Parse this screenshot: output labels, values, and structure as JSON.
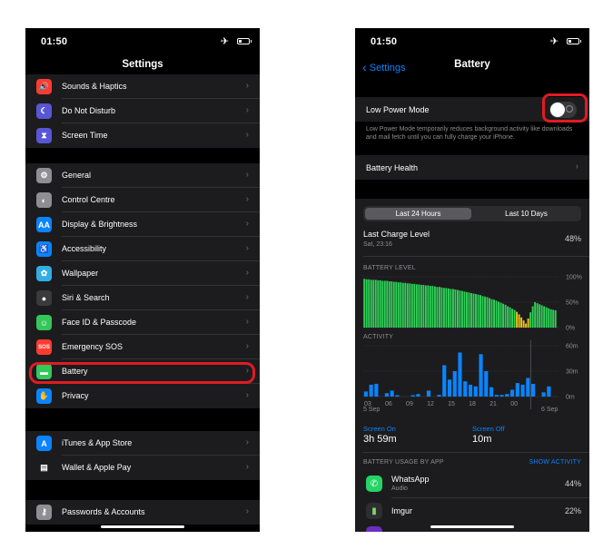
{
  "left": {
    "time": "01:50",
    "title": "Settings",
    "group1": [
      {
        "label": "Sounds & Haptics",
        "icon": "speaker-icon",
        "color": "#ff3b30",
        "glyph": "🔊"
      },
      {
        "label": "Do Not Disturb",
        "icon": "moon-icon",
        "color": "#5856d6",
        "glyph": "☾"
      },
      {
        "label": "Screen Time",
        "icon": "hourglass-icon",
        "color": "#5856d6",
        "glyph": "⧗"
      }
    ],
    "group2": [
      {
        "label": "General",
        "icon": "gear-icon",
        "color": "#8e8e93",
        "glyph": "⚙"
      },
      {
        "label": "Control Centre",
        "icon": "toggles-icon",
        "color": "#8e8e93",
        "glyph": "◐"
      },
      {
        "label": "Display & Brightness",
        "icon": "text-size-icon",
        "color": "#0a84ff",
        "glyph": "AA"
      },
      {
        "label": "Accessibility",
        "icon": "accessibility-icon",
        "color": "#0a84ff",
        "glyph": "♿"
      },
      {
        "label": "Wallpaper",
        "icon": "flower-icon",
        "color": "#32ade6",
        "glyph": "✿"
      },
      {
        "label": "Siri & Search",
        "icon": "siri-icon",
        "color": "#3a3a3c",
        "glyph": "●"
      },
      {
        "label": "Face ID & Passcode",
        "icon": "face-id-icon",
        "color": "#34c759",
        "glyph": "☺"
      },
      {
        "label": "Emergency SOS",
        "icon": "sos-icon",
        "color": "#ff3b30",
        "glyph": "SOS"
      },
      {
        "label": "Battery",
        "icon": "battery-icon",
        "color": "#34c759",
        "glyph": "▬"
      },
      {
        "label": "Privacy",
        "icon": "hand-icon",
        "color": "#0a84ff",
        "glyph": "✋"
      }
    ],
    "group3": [
      {
        "label": "iTunes & App Store",
        "icon": "app-store-icon",
        "color": "#0a84ff",
        "glyph": "A"
      },
      {
        "label": "Wallet & Apple Pay",
        "icon": "wallet-icon",
        "color": "#1c1c1e",
        "glyph": "▤"
      }
    ],
    "group4": [
      {
        "label": "Passwords & Accounts",
        "icon": "key-icon",
        "color": "#8e8e93",
        "glyph": "⚷"
      }
    ]
  },
  "right": {
    "time": "01:50",
    "back_label": "Settings",
    "title": "Battery",
    "low_power_label": "Low Power Mode",
    "low_power_on": false,
    "low_power_note": "Low Power Mode temporarily reduces background activity like downloads and mail fetch until you can fully charge your iPhone.",
    "battery_health_label": "Battery Health",
    "tabs": [
      "Last 24 Hours",
      "Last 10 Days"
    ],
    "last_charge_label": "Last Charge Level",
    "last_charge_time": "Sat, 23:16",
    "last_charge_value": "48%",
    "battery_level_label": "BATTERY LEVEL",
    "battery_level_ticks": [
      "100%",
      "50%",
      "0%"
    ],
    "activity_label": "ACTIVITY",
    "activity_ticks": [
      "60m",
      "30m",
      "0m"
    ],
    "activity_x_labels": [
      "03",
      "06",
      "09",
      "12",
      "15",
      "18",
      "21",
      "00"
    ],
    "date_left": "5 Sep",
    "date_right": "6 Sep",
    "screen_on_label": "Screen On",
    "screen_on_value": "3h 59m",
    "screen_off_label": "Screen Off",
    "screen_off_value": "10m",
    "usage_label": "BATTERY USAGE BY APP",
    "show_activity_label": "SHOW ACTIVITY",
    "apps": [
      {
        "name": "WhatsApp",
        "sub": "Audio",
        "percent": "44%",
        "color": "#25d366"
      },
      {
        "name": "Imgur",
        "sub": "",
        "percent": "22%",
        "color": "#2e2e30"
      }
    ]
  },
  "chart_data": [
    {
      "type": "bar",
      "title": "BATTERY LEVEL",
      "ylim": [
        0,
        100
      ],
      "unit": "%",
      "values": [
        96,
        95,
        95,
        94,
        94,
        94,
        93,
        93,
        92,
        92,
        92,
        91,
        91,
        90,
        90,
        89,
        89,
        88,
        88,
        87,
        87,
        86,
        86,
        85,
        85,
        84,
        84,
        83,
        83,
        82,
        82,
        81,
        80,
        80,
        79,
        78,
        78,
        77,
        76,
        76,
        75,
        74,
        73,
        72,
        71,
        70,
        69,
        68,
        67,
        66,
        65,
        64,
        62,
        61,
        60,
        58,
        56,
        55,
        53,
        51,
        49,
        47,
        45,
        42,
        40,
        37,
        35,
        31,
        26,
        20,
        14,
        8,
        18,
        30,
        42,
        50,
        48,
        46,
        44,
        42,
        40,
        38,
        36,
        35,
        34
      ],
      "charging_from_index": 67
    },
    {
      "type": "bar",
      "title": "ACTIVITY",
      "ylim": [
        0,
        60
      ],
      "unit": "m",
      "screen_on": [
        6,
        14,
        15,
        0,
        4,
        7,
        1,
        0,
        0,
        1,
        3,
        0,
        7,
        0,
        2,
        37,
        20,
        30,
        52,
        18,
        14,
        12,
        50,
        30,
        11,
        2,
        2,
        3,
        8,
        16,
        14,
        22,
        15,
        0,
        5,
        12,
        0
      ]
    }
  ]
}
